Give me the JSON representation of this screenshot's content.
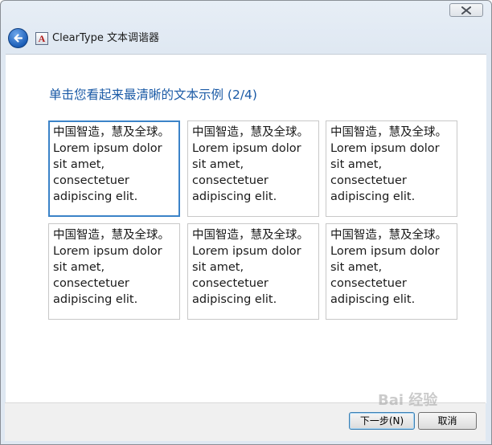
{
  "window": {
    "title": "ClearType 文本调谐器",
    "app_icon_glyph": "A",
    "close_icon": "close-icon",
    "back_icon": "back-arrow-icon"
  },
  "instruction": "单击您看起来最清晰的文本示例 (2/4)",
  "samples": [
    {
      "line1": "中国智造，慧及全球。",
      "line2": "Lorem ipsum dolor",
      "line3": "sit amet,",
      "line4": "consectetuer",
      "line5": "adipiscing elit.",
      "selected": true
    },
    {
      "line1": "中国智造，慧及全球。",
      "line2": "Lorem ipsum dolor",
      "line3": "sit amet,",
      "line4": "consectetuer",
      "line5": "adipiscing elit.",
      "selected": false
    },
    {
      "line1": "中国智造，慧及全球。",
      "line2": "Lorem ipsum dolor",
      "line3": "sit amet,",
      "line4": "consectetuer",
      "line5": "adipiscing elit.",
      "selected": false
    },
    {
      "line1": "中国智造，慧及全球。",
      "line2": "Lorem ipsum dolor",
      "line3": "sit amet,",
      "line4": "consectetuer",
      "line5": "adipiscing elit.",
      "selected": false
    },
    {
      "line1": "中国智造，慧及全球。",
      "line2": "Lorem ipsum dolor",
      "line3": "sit amet,",
      "line4": "consectetuer",
      "line5": "adipiscing elit.",
      "selected": false
    },
    {
      "line1": "中国智造，慧及全球。",
      "line2": "Lorem ipsum dolor",
      "line3": "sit amet,",
      "line4": "consectetuer",
      "line5": "adipiscing elit.",
      "selected": false
    }
  ],
  "buttons": {
    "next": "下一步(N)",
    "cancel": "取消"
  },
  "watermark": "Bai 经验",
  "colors": {
    "instruction_text": "#1a5aa6",
    "selected_border": "#3b83c8"
  }
}
